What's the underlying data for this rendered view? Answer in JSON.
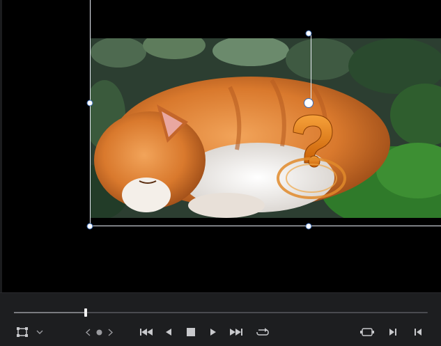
{
  "viewer": {
    "overlay_icon": "question-mark-ring-icon"
  },
  "playback": {
    "progress": 0.174
  },
  "toolbar": {
    "transform_icon": "transform-box-icon",
    "dropdown_icon": "chevron-down-icon",
    "prev_keyframe_icon": "chevron-left-icon",
    "keyframe_icon": "keyframe-dot-icon",
    "next_keyframe_icon": "chevron-right-icon",
    "skip_start_icon": "skip-to-start-icon",
    "step_back_icon": "step-back-icon",
    "stop_icon": "stop-icon",
    "play_icon": "play-icon",
    "skip_end_icon": "skip-to-end-icon",
    "loop_icon": "loop-icon",
    "match_frame_icon": "match-frame-icon",
    "mark_in_icon": "mark-in-icon",
    "mark_out_icon": "mark-out-icon"
  },
  "colors": {
    "background": "#000000",
    "panel": "#1d1e20",
    "handle_border": "#3c6cb5",
    "overlay_orange": "#e07a10"
  }
}
